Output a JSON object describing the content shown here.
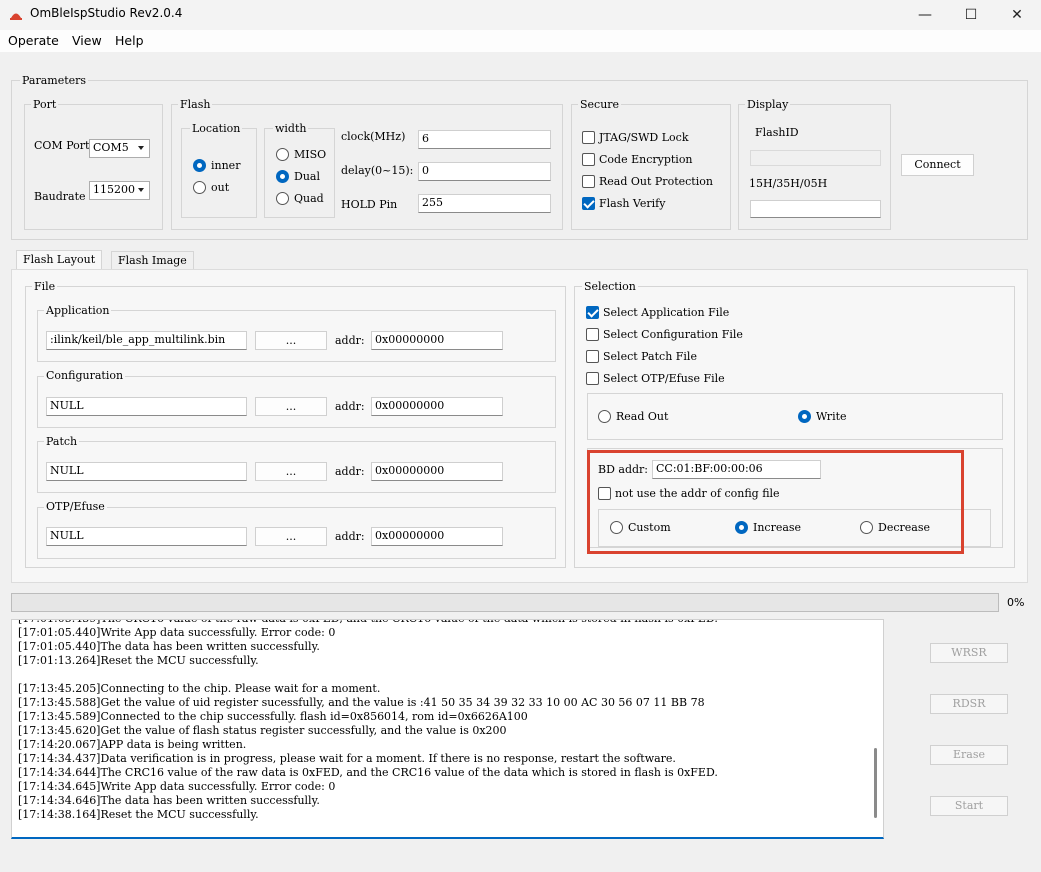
{
  "window": {
    "title": "OmBleIspStudio Rev2.0.4",
    "controls": {
      "minimize": "—",
      "maximize": "☐",
      "close": "✕"
    }
  },
  "menu": [
    "Operate",
    "View",
    "Help"
  ],
  "parameters": {
    "label": "Parameters",
    "port": {
      "label": "Port",
      "com_label": "COM Port",
      "com_value": "COM5",
      "baud_label": "Baudrate",
      "baud_value": "115200"
    },
    "flash": {
      "label": "Flash",
      "location": {
        "label": "Location",
        "inner": "inner",
        "out": "out",
        "selected": "inner"
      },
      "width": {
        "label": "width",
        "miso": "MISO",
        "dual": "Dual",
        "quad": "Quad",
        "selected": "Dual"
      },
      "clock_label": "clock(MHz)",
      "clock_value": "6",
      "delay_label": "delay(0~15):",
      "delay_value": "0",
      "hold_label": "HOLD Pin",
      "hold_value": "255"
    },
    "secure": {
      "label": "Secure",
      "items": [
        {
          "label": "JTAG/SWD Lock",
          "checked": false
        },
        {
          "label": "Code Encryption",
          "checked": false
        },
        {
          "label": "Read Out Protection",
          "checked": false
        },
        {
          "label": "Flash Verify",
          "checked": true
        }
      ]
    },
    "display": {
      "label": "Display",
      "flashid_label": "FlashID",
      "flashid_value": "",
      "id_label": "15H/35H/05H",
      "id_value": ""
    },
    "connect_button": "Connect"
  },
  "tabs": [
    {
      "label": "Flash Layout",
      "active": true
    },
    {
      "label": "Flash Image",
      "active": false
    }
  ],
  "file": {
    "label": "File",
    "rows": [
      {
        "label": "Application",
        "path": ":ilink/keil/ble_app_multilink.bin",
        "browse": "...",
        "addr_label": "addr:",
        "addr": "0x00000000"
      },
      {
        "label": "Configuration",
        "path": "NULL",
        "browse": "...",
        "addr_label": "addr:",
        "addr": "0x00000000"
      },
      {
        "label": "Patch",
        "path": "NULL",
        "browse": "...",
        "addr_label": "addr:",
        "addr": "0x00000000"
      },
      {
        "label": "OTP/Efuse",
        "path": "NULL",
        "browse": "...",
        "addr_label": "addr:",
        "addr": "0x00000000"
      }
    ]
  },
  "selection": {
    "label": "Selection",
    "items": [
      {
        "label": "Select Application File",
        "checked": true
      },
      {
        "label": "Select Configuration File",
        "checked": false
      },
      {
        "label": "Select Patch File",
        "checked": false
      },
      {
        "label": "Select OTP/Efuse File",
        "checked": false
      }
    ],
    "mode": {
      "read": "Read Out",
      "write": "Write",
      "selected": "Write"
    },
    "bd": {
      "label": "BD addr:",
      "value": "CC:01:BF:00:00:06",
      "not_use_label": "not use the addr of config file",
      "not_use_checked": false,
      "custom": "Custom",
      "increase": "Increase",
      "decrease": "Decrease",
      "selected": "Increase"
    },
    "highlight_color": "#d9432f"
  },
  "progress": {
    "value": 0,
    "label": "0%"
  },
  "log": [
    "[17:01:05.440]Write App data successfully. Error code: 0",
    "[17:01:05.440]The data has been written successfully.",
    "[17:01:13.264]Reset the MCU successfully.",
    "",
    "[17:13:45.205]Connecting to the chip. Please wait for a moment.",
    "[17:13:45.588]Get the value of uid register sucessfully, and the value is :41 50 35 34 39 32 33 10 00 AC 30 56 07 11 BB 78",
    "[17:13:45.589]Connected to the chip successfully. flash id=0x856014, rom id=0x6626A100",
    "[17:13:45.620]Get the value of flash status register successfully, and the value is 0x200",
    "[17:14:20.067]APP data is being written.",
    "[17:14:34.437]Data verification is in progress, please wait for a moment. If there is no response, restart the software.",
    "[17:14:34.644]The CRC16 value of the raw data is 0xFED, and the CRC16 value of the data which is stored in flash is 0xFED.",
    "[17:14:34.645]Write App data successfully. Error code: 0",
    "[17:14:34.646]The data has been written successfully.",
    "[17:14:38.164]Reset the MCU successfully."
  ],
  "side_buttons": {
    "wrsr": "WRSR",
    "rdsr": "RDSR",
    "erase": "Erase",
    "start": "Start"
  },
  "colors": {
    "accent": "#0067c0",
    "background": "#f0f0f0"
  }
}
